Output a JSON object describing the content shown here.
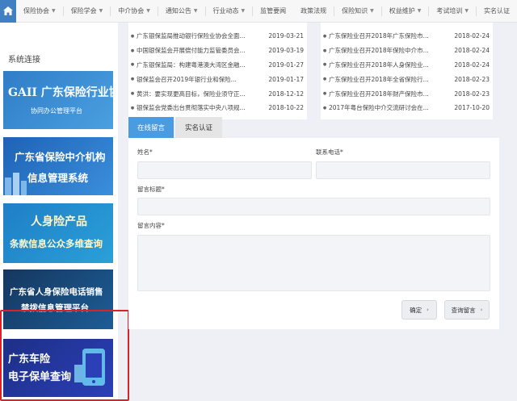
{
  "nav": {
    "items": [
      {
        "label": "保险协会"
      },
      {
        "label": "保险学会"
      },
      {
        "label": "中介协会"
      },
      {
        "label": "通知公告"
      },
      {
        "label": "行业动态"
      },
      {
        "label": "监管要闻"
      },
      {
        "label": "政策法规"
      },
      {
        "label": "保险知识"
      },
      {
        "label": "权益维护"
      },
      {
        "label": "考试培训"
      },
      {
        "label": "实名认证"
      }
    ]
  },
  "sidebar": {
    "title": "系统连接",
    "banners": [
      {
        "line1": "GAII 广东保险行业协会",
        "line2": "协同办公管理平台"
      },
      {
        "line1": "广东省保险中介机构",
        "line2": "信息管理系统"
      },
      {
        "line1": "人身险产品",
        "line2": "条款信息公众多维查询"
      },
      {
        "line1": "广东省人身保险电话销售",
        "line2": "禁拨信息管理平台"
      },
      {
        "line1": "广东车险",
        "line2": "电子保单查询"
      }
    ]
  },
  "news_left": [
    {
      "title": "广东银保监局推动银行保险业协会全面...",
      "date": "2019-03-21"
    },
    {
      "title": "中国银保监会开展偿付能力监管委员会...",
      "date": "2019-03-19"
    },
    {
      "title": "广东银保监局：构建粤港澳大湾区金融...",
      "date": "2019-01-27"
    },
    {
      "title": "银保监会召开2019年银行业和保险...",
      "date": "2019-01-17"
    },
    {
      "title": "黄洪：要实现更高目标，保险业须守正...",
      "date": "2018-12-12"
    },
    {
      "title": "银保监会党委出台贯彻落实中央八项规...",
      "date": "2018-10-22"
    }
  ],
  "news_right": [
    {
      "title": "广东保险业召开2018年广东保险市...",
      "date": "2018-02-24"
    },
    {
      "title": "广东保险业召开2018年保险中介市...",
      "date": "2018-02-24"
    },
    {
      "title": "广东保险业召开2018年人身保险业...",
      "date": "2018-02-24"
    },
    {
      "title": "广东保险业召开2018年全省保险行...",
      "date": "2018-02-23"
    },
    {
      "title": "广东保险业召开2018年财产保险市...",
      "date": "2018-02-23"
    },
    {
      "title": "2017年粤台保险中介交流研讨会在...",
      "date": "2017-10-20"
    }
  ],
  "tabs": {
    "message": "在线留言",
    "realname": "实名认证"
  },
  "form": {
    "name_label": "姓名*",
    "phone_label": "联系电话*",
    "subject_label": "留言标题*",
    "content_label": "留言内容*",
    "name_value": "",
    "phone_value": "",
    "subject_value": "",
    "content_value": "",
    "confirm_label": "确定",
    "query_label": "查询留言"
  },
  "colors": {
    "accent": "#4a9be0",
    "highlight_border": "#d8232a"
  }
}
